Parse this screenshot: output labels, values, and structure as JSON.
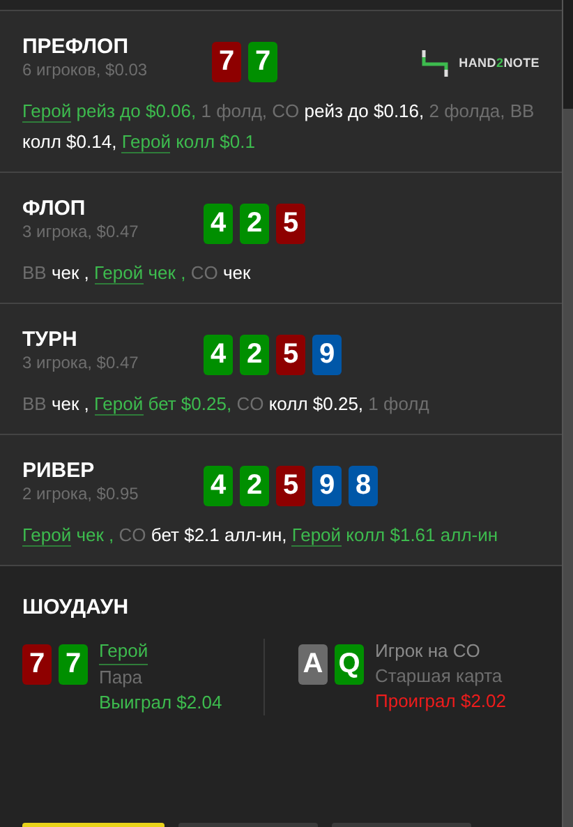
{
  "logo": {
    "prefix": "HAND",
    "accent": "2",
    "suffix": "NOTE"
  },
  "streets": [
    {
      "title": "ПРЕФЛОП",
      "info": "6 игроков, $0.03",
      "logo": true,
      "cards": [
        {
          "rank": "7",
          "color": "#8e0000"
        },
        {
          "rank": "7",
          "color": "#008f00"
        }
      ],
      "actions": [
        {
          "kind": "hero",
          "actor": "Герой",
          "text": "рейз до $0.06,"
        },
        {
          "kind": "note",
          "text": "1 фолд,"
        },
        {
          "kind": "player",
          "actor": "CO",
          "text": "рейз до $0.16,"
        },
        {
          "kind": "note",
          "text": "2 фолда,"
        },
        {
          "kind": "player",
          "actor": "BB",
          "text": "колл $0.14,"
        },
        {
          "kind": "hero",
          "actor": "Герой",
          "text": "колл $0.1"
        }
      ]
    },
    {
      "title": "ФЛОП",
      "info": "3 игрока, $0.47",
      "logo": false,
      "cards": [
        {
          "rank": "4",
          "color": "#008f00"
        },
        {
          "rank": "2",
          "color": "#008f00"
        },
        {
          "rank": "5",
          "color": "#8e0000"
        }
      ],
      "actions": [
        {
          "kind": "player",
          "actor": "BB",
          "text": "чек ,"
        },
        {
          "kind": "hero",
          "actor": "Герой",
          "text": "чек ,"
        },
        {
          "kind": "player",
          "actor": "CO",
          "text": "чек"
        }
      ]
    },
    {
      "title": "ТУРН",
      "info": "3 игрока, $0.47",
      "logo": false,
      "cards": [
        {
          "rank": "4",
          "color": "#008f00"
        },
        {
          "rank": "2",
          "color": "#008f00"
        },
        {
          "rank": "5",
          "color": "#8e0000"
        },
        {
          "rank": "9",
          "color": "#0057a8"
        }
      ],
      "actions": [
        {
          "kind": "player",
          "actor": "BB",
          "text": "чек ,"
        },
        {
          "kind": "hero",
          "actor": "Герой",
          "text": "бет $0.25,"
        },
        {
          "kind": "player",
          "actor": "CO",
          "text": "колл $0.25,"
        },
        {
          "kind": "note",
          "text": "1 фолд"
        }
      ]
    },
    {
      "title": "РИВЕР",
      "info": "2 игрока, $0.95",
      "logo": false,
      "cards": [
        {
          "rank": "4",
          "color": "#008f00"
        },
        {
          "rank": "2",
          "color": "#008f00"
        },
        {
          "rank": "5",
          "color": "#8e0000"
        },
        {
          "rank": "9",
          "color": "#0057a8"
        },
        {
          "rank": "8",
          "color": "#0057a8"
        }
      ],
      "actions": [
        {
          "kind": "hero",
          "actor": "Герой",
          "text": "чек ,"
        },
        {
          "kind": "player",
          "actor": "CO",
          "text": "бет $2.1 алл-ин,"
        },
        {
          "kind": "hero",
          "actor": "Герой",
          "text": "колл $1.61 алл-ин"
        }
      ]
    }
  ],
  "showdown": {
    "title": "ШОУДАУН",
    "players": [
      {
        "kind": "hero",
        "name": "Герой",
        "hand": "Пара",
        "result": "Выиграл $2.04",
        "won": true,
        "cards": [
          {
            "rank": "7",
            "color": "#8e0000"
          },
          {
            "rank": "7",
            "color": "#008f00"
          }
        ]
      },
      {
        "kind": "player",
        "name": "Игрок на CO",
        "hand": "Старшая карта",
        "result": "Проиграл $2.02",
        "won": false,
        "cards": [
          {
            "rank": "A",
            "color": "#6b6b6b"
          },
          {
            "rank": "Q",
            "color": "#008f00"
          }
        ]
      }
    ]
  },
  "buttons": [
    {
      "color": "#e8d21a"
    },
    {
      "color": "#3a3a3a"
    },
    {
      "color": "#3a3a3a"
    }
  ]
}
